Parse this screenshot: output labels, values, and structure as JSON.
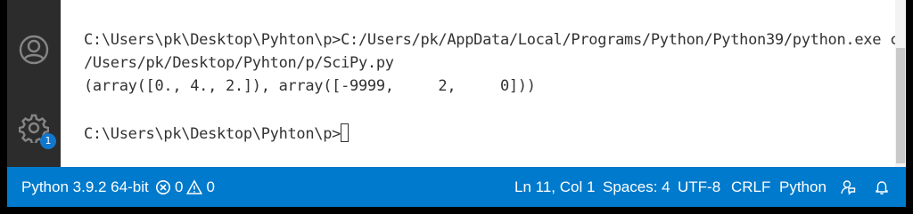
{
  "terminal": {
    "lines": [
      "C:\\Users\\pk\\Desktop\\Pyhton\\p>C:/Users/pk/AppData/Local/Programs/Python/Python39/python.exe c:",
      "/Users/pk/Desktop/Pyhton/p/SciPy.py",
      "(array([0., 4., 2.]), array([-9999,     2,     0]))"
    ],
    "prompt": "C:\\Users\\pk\\Desktop\\Pyhton\\p>"
  },
  "activity_bar": {
    "icons": [
      "account-icon",
      "settings-gear-icon"
    ],
    "settings_badge": "1"
  },
  "status_bar": {
    "interpreter": "Python 3.9.2 64-bit",
    "errors": "0",
    "warnings": "0",
    "position": "Ln 11, Col 1",
    "spaces": "Spaces: 4",
    "encoding": "UTF-8",
    "eol": "CRLF",
    "language": "Python",
    "icons": [
      "error-icon",
      "warning-icon",
      "feedback-icon",
      "bell-icon"
    ]
  },
  "colors": {
    "status_bar": "#007acc",
    "activity_bar": "#2c2c2c",
    "badge": "#1177cc"
  }
}
